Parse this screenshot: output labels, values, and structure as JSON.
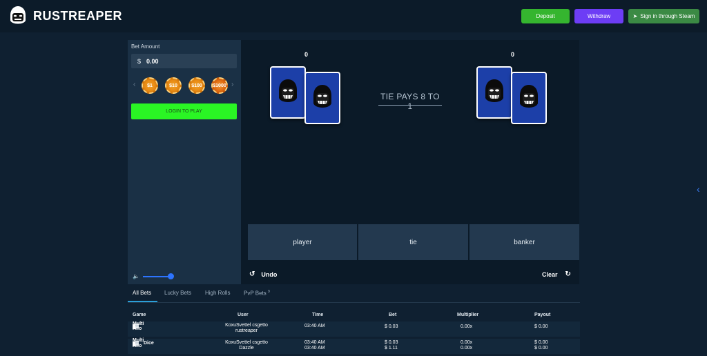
{
  "header": {
    "brand": "RUSTREAPER",
    "deposit_label": "Deposit",
    "withdraw_label": "Withdraw",
    "steam_label": "Sign in through Steam"
  },
  "bet_panel": {
    "label": "Bet Amount",
    "currency": "$",
    "amount": "0.00",
    "chips": [
      "$1",
      "$10",
      "$100",
      "$1000"
    ],
    "login_label": "LOGIN TO PLAY",
    "volume_level": 0.85
  },
  "game": {
    "player_score": "0",
    "banker_score": "0",
    "tie_text": "TIE PAYS 8 TO 1",
    "player_label": "player",
    "tie_label": "tie",
    "banker_label": "banker",
    "undo_label": "Undo",
    "clear_label": "Clear"
  },
  "tabs": {
    "all_bets": "All Bets",
    "lucky_bets": "Lucky Bets",
    "high_rolls": "High Rolls",
    "pvp_bets": "PvP Bets",
    "pvp_count": "9"
  },
  "table": {
    "headers": [
      "Game",
      "User",
      "Time",
      "Bet",
      "Multiplier",
      "Payout"
    ],
    "rows": [
      {
        "game": "Multi Hilo",
        "user1": "KoxuSvettel csgetto",
        "user2": "rustreaper",
        "time": "03:40 AM",
        "bet": "$ 0.03",
        "multiplier": "0.00x",
        "payout": "$ 0.00"
      },
      {
        "game": "Multi Hilo",
        "game2": "Dice",
        "user1": "KoxuSvettel csgetto",
        "user2": "Dazzle",
        "time": "03:40 AM",
        "bet": "$ 0.03",
        "bet2": "$ 1.11",
        "multiplier": "0.00x",
        "multiplier2": "0.00x",
        "payout": "$ 0.00",
        "payout2": "$ 0.00"
      }
    ]
  },
  "colors": {
    "background": "#0f2031",
    "deposit": "#35b52f",
    "withdraw": "#6d3df5",
    "steam": "#3b8a44",
    "login": "#2af524",
    "card": "#1c3fa8",
    "accent_blue": "#2d74ff"
  }
}
